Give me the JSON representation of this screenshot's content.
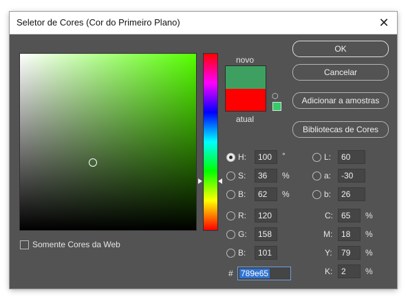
{
  "window": {
    "title": "Seletor de Cores (Cor do Primeiro Plano)",
    "close_glyph": "✕"
  },
  "swatches": {
    "new_label": "novo",
    "current_label": "atual",
    "new_color": "#3ea060",
    "current_color": "#ff0000"
  },
  "buttons": {
    "ok": "OK",
    "cancel": "Cancelar",
    "add_to_swatches": "Adicionar a amostras",
    "color_libraries": "Bibliotecas de Cores"
  },
  "hsb": {
    "h": {
      "label": "H:",
      "value": "100",
      "unit": "°"
    },
    "s": {
      "label": "S:",
      "value": "36",
      "unit": "%"
    },
    "b": {
      "label": "B:",
      "value": "62",
      "unit": "%"
    }
  },
  "rgb": {
    "r": {
      "label": "R:",
      "value": "120"
    },
    "g": {
      "label": "G:",
      "value": "158"
    },
    "b": {
      "label": "B:",
      "value": "101"
    }
  },
  "lab": {
    "l": {
      "label": "L:",
      "value": "60"
    },
    "a": {
      "label": "a:",
      "value": "-30"
    },
    "b": {
      "label": "b:",
      "value": "26"
    }
  },
  "cmyk": {
    "c": {
      "label": "C:",
      "value": "65",
      "unit": "%"
    },
    "m": {
      "label": "M:",
      "value": "18",
      "unit": "%"
    },
    "y": {
      "label": "Y:",
      "value": "79",
      "unit": "%"
    },
    "k": {
      "label": "K:",
      "value": "2",
      "unit": "%"
    }
  },
  "hex": {
    "label": "#",
    "value": "789e65"
  },
  "web_only": {
    "label": "Somente Cores da Web",
    "checked": false
  },
  "icons": {
    "cube": "cube-icon",
    "close": "close-icon"
  }
}
